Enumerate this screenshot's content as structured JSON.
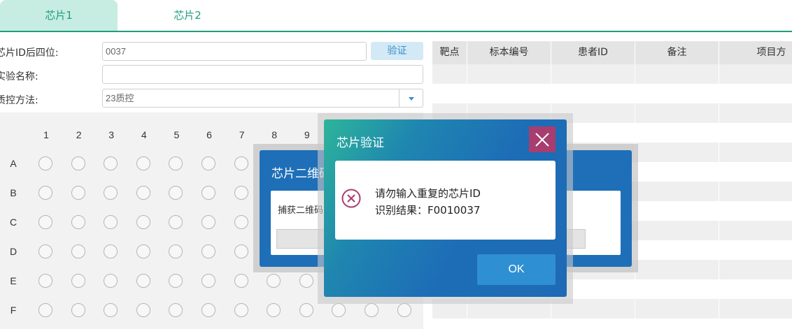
{
  "tabs": [
    {
      "label": "芯片1",
      "active": true
    },
    {
      "label": "芯片2",
      "active": false
    }
  ],
  "form": {
    "chip_id_label": "芯片ID后四位:",
    "chip_id_value": "0037",
    "verify_button": "验证",
    "experiment_name_label": "实验名称:",
    "experiment_name_value": "",
    "qc_method_label": "质控方法:",
    "qc_method_value": "23质控"
  },
  "plate": {
    "columns": [
      "1",
      "2",
      "3",
      "4",
      "5",
      "6",
      "7",
      "8",
      "9"
    ],
    "rows": [
      "A",
      "B",
      "C",
      "D",
      "E",
      "F"
    ]
  },
  "table": {
    "headers": [
      "靶点",
      "标本编号",
      "患者ID",
      "备注",
      "项目方"
    ]
  },
  "back_dialog": {
    "title": "芯片二维码",
    "body_text": "捕获二维码"
  },
  "dialog": {
    "title": "芯片验证",
    "message_line1": "请勿输入重复的芯片ID",
    "message_line2": "识别结果：F0010037",
    "ok_button": "OK"
  },
  "colors": {
    "accent_green": "#1f9e7a",
    "dialog_blue": "#1e6fb8",
    "close_button": "#a83d70",
    "error_icon": "#a83d70",
    "ok_button": "#2f8fd3"
  },
  "icons": {
    "close": "close-icon",
    "error": "error-circle-x-icon",
    "dropdown": "chevron-down-icon"
  }
}
